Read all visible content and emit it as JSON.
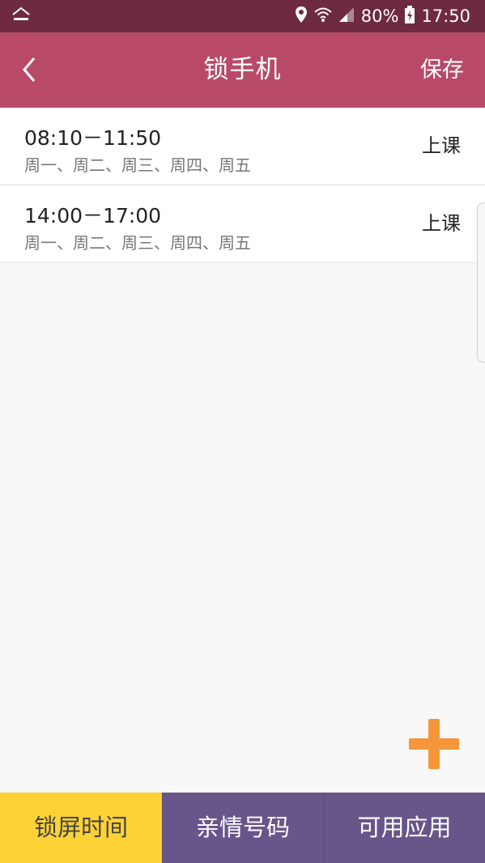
{
  "status_bar": {
    "battery": "80%",
    "time": "17:50",
    "icons": [
      "smart-home-icon",
      "location-icon",
      "wifi-icon",
      "signal-icon",
      "battery-charging-icon"
    ]
  },
  "header": {
    "title": "锁手机",
    "save_label": "保存"
  },
  "schedules": [
    {
      "time": "08:10－11:50",
      "days": "周一、周二、周三、周四、周五",
      "mode": "上课"
    },
    {
      "time": "14:00－17:00",
      "days": "周一、周二、周三、周四、周五",
      "mode": "上课"
    }
  ],
  "tabs": [
    "锁屏时间",
    "亲情号码",
    "可用应用"
  ],
  "colors": {
    "status_bar": "#6e2a40",
    "header": "#b84a68",
    "fab": "#f5963a",
    "tab_active": "#fcd236",
    "tab_inactive": "#68558a"
  }
}
